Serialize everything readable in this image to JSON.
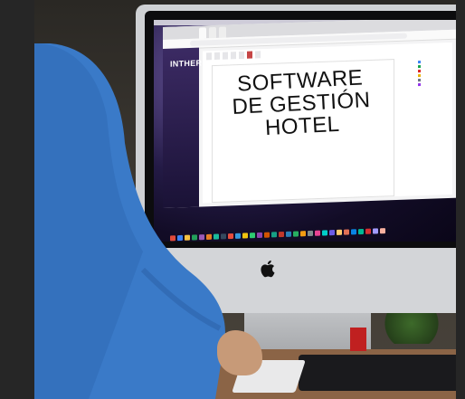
{
  "headline": {
    "line1": "SOFTWARE",
    "line2": "DE GESTIÓN",
    "line3": "HOTEL"
  },
  "screen": {
    "logo_text": "INTHER",
    "browser_tabs": [
      "",
      "",
      ""
    ],
    "nav_tabs": [
      "",
      "",
      "",
      "",
      "",
      "",
      ""
    ],
    "legend_items": [
      {
        "label": "",
        "color": "#3b82f6"
      },
      {
        "label": "",
        "color": "#16a34a"
      },
      {
        "label": "",
        "color": "#dc2626"
      },
      {
        "label": "",
        "color": "#eab308"
      },
      {
        "label": "",
        "color": "#6b7280"
      },
      {
        "label": "",
        "color": "#9333ea"
      }
    ]
  },
  "colors": {
    "sidebar": "#3b2a63",
    "accent": "#c64545",
    "sweater": "#3a7ac8"
  },
  "icons": [
    "apple-logo-icon"
  ]
}
